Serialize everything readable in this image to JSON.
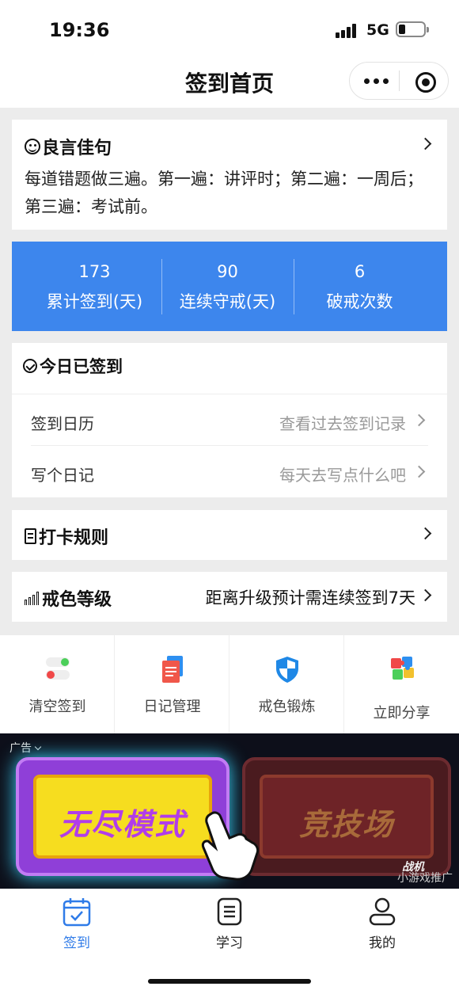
{
  "status_bar": {
    "time": "19:36",
    "network": "5G"
  },
  "nav": {
    "title": "签到首页"
  },
  "quote": {
    "title": "良言佳句",
    "text": "每道错题做三遍。第一遍：讲评时；第二遍：一周后；第三遍：考试前。"
  },
  "stats": [
    {
      "value": "173",
      "label": "累计签到(天)"
    },
    {
      "value": "90",
      "label": "连续守戒(天)"
    },
    {
      "value": "6",
      "label": "破戒次数"
    }
  ],
  "today": {
    "title": "今日已签到",
    "rows": [
      {
        "label": "签到日历",
        "hint": "查看过去签到记录"
      },
      {
        "label": "写个日记",
        "hint": "每天去写点什么吧"
      }
    ]
  },
  "rules": {
    "title": "打卡规则"
  },
  "level": {
    "title": "戒色等级",
    "hint": "距离升级预计需连续签到7天"
  },
  "quick_actions": [
    {
      "label": "清空签到",
      "icon": "toggle-icon"
    },
    {
      "label": "日记管理",
      "icon": "documents-icon"
    },
    {
      "label": "戒色锻炼",
      "icon": "shield-icon"
    },
    {
      "label": "立即分享",
      "icon": "puzzle-icon"
    }
  ],
  "ad": {
    "tag": "广告",
    "tile1_text": "无尽模式",
    "tile2_text": "竞技场",
    "logo_text": "战机",
    "source": "小游戏推广"
  },
  "tabs": [
    {
      "label": "签到",
      "icon": "calendar-check-icon",
      "active": true
    },
    {
      "label": "学习",
      "icon": "list-icon",
      "active": false
    },
    {
      "label": "我的",
      "icon": "user-icon",
      "active": false
    }
  ],
  "colors": {
    "accent": "#3d86ed",
    "tab_active": "#2f7be8",
    "background": "#ececec"
  }
}
